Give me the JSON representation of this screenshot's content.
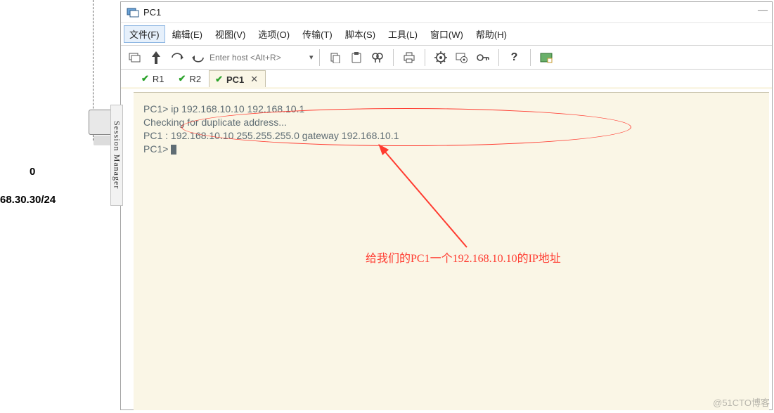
{
  "background": {
    "node_label": "0",
    "subnet": "68.30.30/24",
    "session_manager": "Session Manager"
  },
  "window": {
    "title": "PC1",
    "minimize": "—"
  },
  "menu": {
    "file": "文件(F)",
    "edit": "编辑(E)",
    "view": "视图(V)",
    "options": "选项(O)",
    "transfer": "传输(T)",
    "script": "脚本(S)",
    "tools": "工具(L)",
    "window": "窗口(W)",
    "help": "帮助(H)"
  },
  "toolbar": {
    "host_placeholder": "Enter host <Alt+R>"
  },
  "tabs": {
    "r1": "R1",
    "r2": "R2",
    "pc1": "PC1",
    "close": "✕"
  },
  "terminal": {
    "l1": "PC1> ip 192.168.10.10 192.168.10.1",
    "l2": "Checking for duplicate address...",
    "l3": "PC1 : 192.168.10.10 255.255.255.0 gateway 192.168.10.1",
    "l4": "",
    "l5": "PC1> "
  },
  "annotation": "给我们的PC1一个192.168.10.10的IP地址",
  "watermark": "@51CTO博客"
}
